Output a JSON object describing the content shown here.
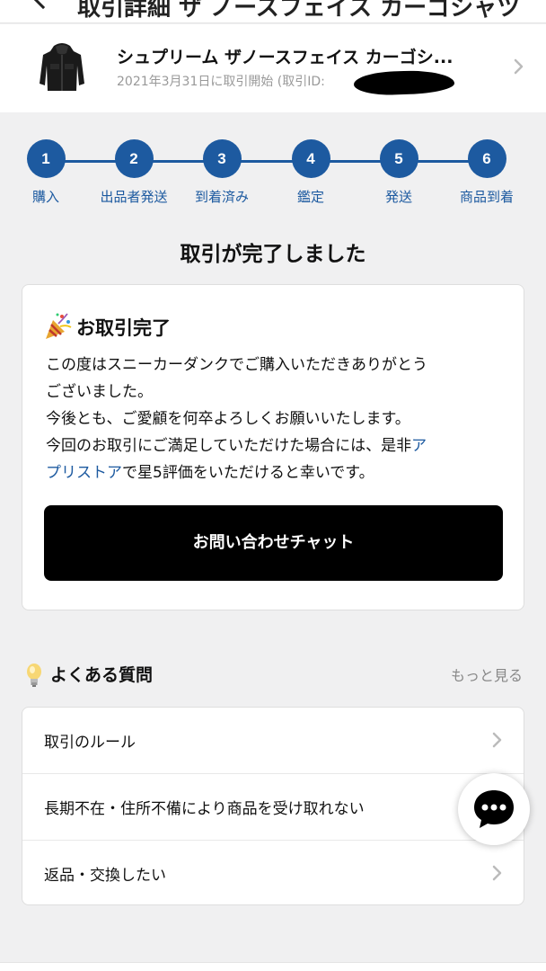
{
  "topbar": {
    "title": "取引詳細 ザ ノースフェイス カーゴシャツ"
  },
  "product": {
    "name": "シュプリーム ザノースフェイス カーゴシ...",
    "date_text": "2021年3月31日に取引開始 (取引ID:"
  },
  "steps": [
    {
      "num": "1",
      "label": "購入"
    },
    {
      "num": "2",
      "label": "出品者発送"
    },
    {
      "num": "3",
      "label": "到着済み"
    },
    {
      "num": "4",
      "label": "鑑定"
    },
    {
      "num": "5",
      "label": "発送"
    },
    {
      "num": "6",
      "label": "商品到着"
    }
  ],
  "status_headline": "取引が完了しました",
  "completion_card": {
    "title": "お取引完了",
    "line1": "この度はスニーカーダンクでご購入いただきありがとう",
    "line2": "ございました。",
    "line3": "今後とも、ご愛顧を何卒よろしくお願いいたします。",
    "line4_pre": "今回のお取引にご満足していただけた場合には、是非",
    "line4_link": "ア",
    "line5_link": "プリストア",
    "line5_post": "で星5評価をいただけると幸いです。",
    "button_label": "お問い合わせチャット"
  },
  "faq": {
    "title": "よくある質問",
    "more_label": "もっと見る",
    "items": [
      {
        "label": "取引のルール"
      },
      {
        "label": "長期不在・住所不備により商品を受け取れない"
      },
      {
        "label": "返品・交換したい"
      }
    ]
  },
  "colors": {
    "accent_blue": "#1d5aa0",
    "background": "#f0f0f1",
    "button_black": "#000000"
  }
}
